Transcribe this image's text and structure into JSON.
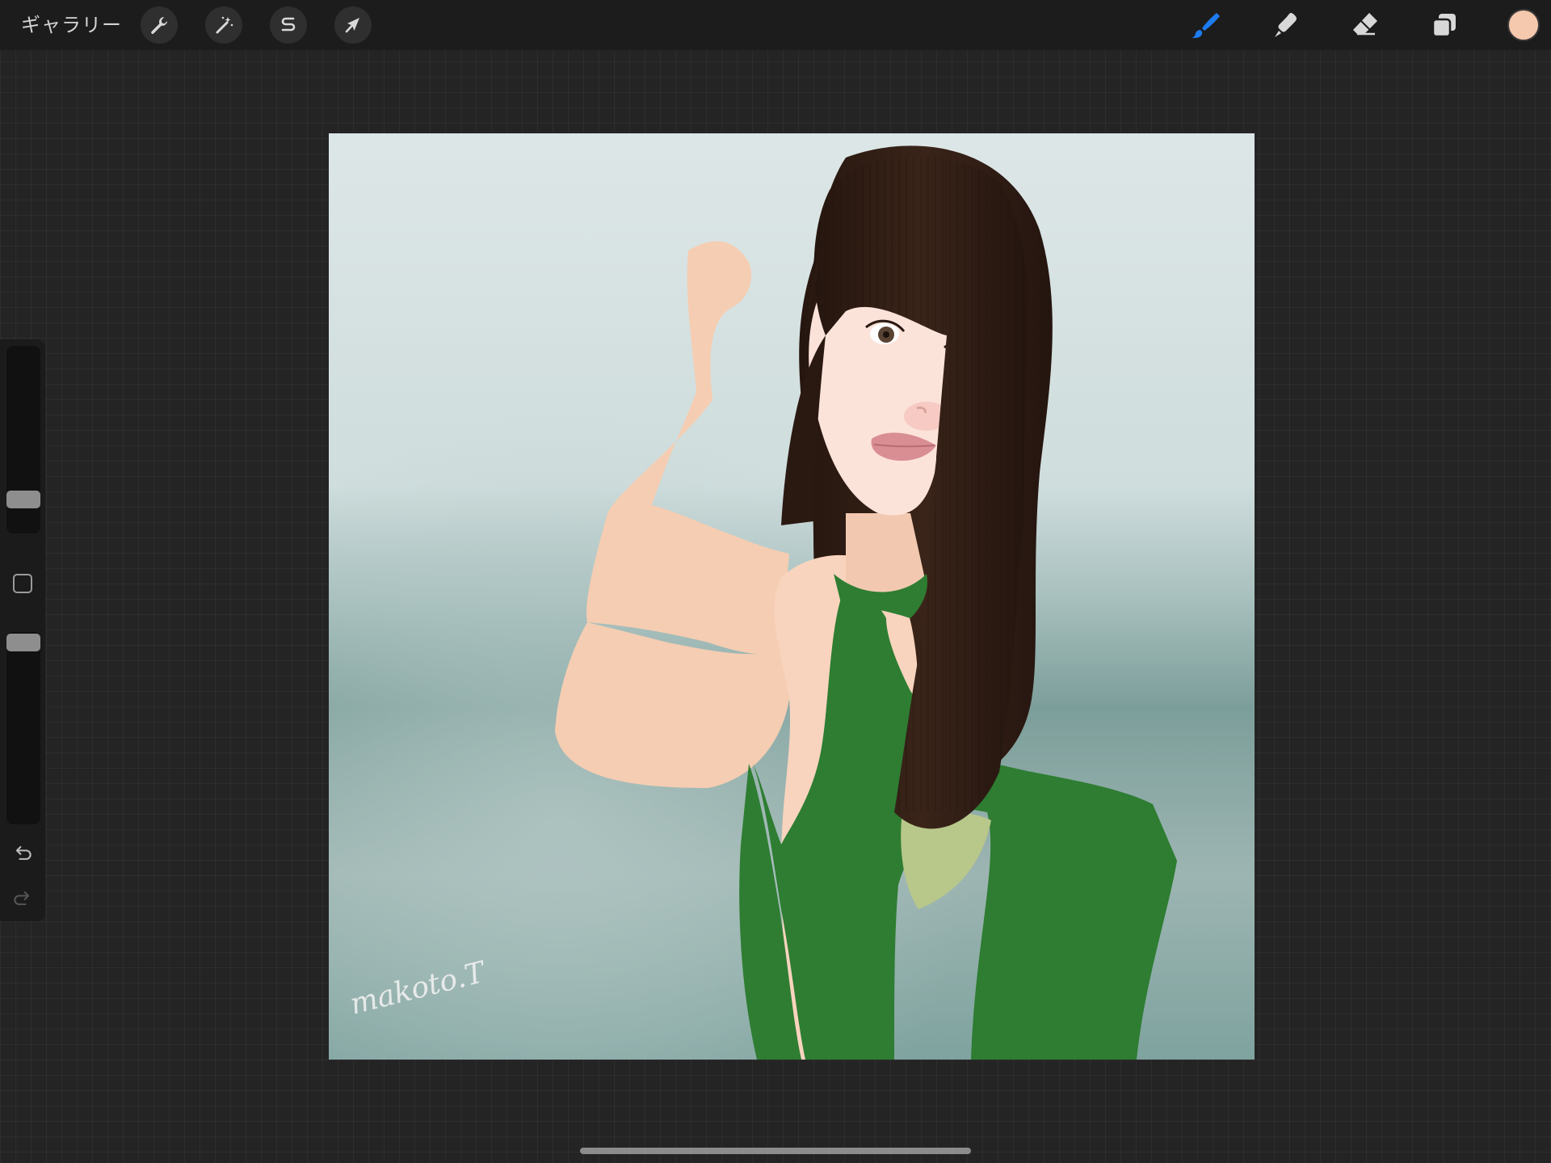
{
  "toolbar": {
    "gallery_label": "ギャラリー",
    "left_tools": [
      {
        "name": "actions",
        "icon": "wrench-icon"
      },
      {
        "name": "adjustments",
        "icon": "magic-wand-icon"
      },
      {
        "name": "selection",
        "icon": "selection-s-icon"
      },
      {
        "name": "transform",
        "icon": "arrow-cursor-icon"
      }
    ],
    "right_tools": [
      {
        "name": "brush",
        "icon": "brush-icon",
        "active": true
      },
      {
        "name": "smudge",
        "icon": "smudge-icon",
        "active": false
      },
      {
        "name": "eraser",
        "icon": "eraser-icon",
        "active": false
      },
      {
        "name": "layers",
        "icon": "layers-icon",
        "active": false
      }
    ],
    "current_color": "#F5C9AE",
    "active_color": "#1E7BF0"
  },
  "sidebar": {
    "brush_size_level": 0.2,
    "opacity_level": 1.0,
    "buttons": [
      "modify-square-icon",
      "undo-icon",
      "redo-icon"
    ]
  },
  "artwork": {
    "signature": "makoto.T",
    "palette": {
      "sky_top": "#DDE6E6",
      "sea": "#7FA39F",
      "hair": "#2E1C15",
      "skin": "#F8D4BE",
      "dress": "#2E7D32",
      "dress_inner": "#B8C78A",
      "lips": "#D98E94"
    }
  }
}
